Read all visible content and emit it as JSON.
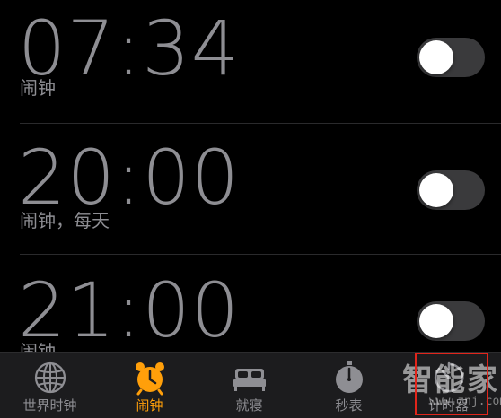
{
  "alarms": [
    {
      "time": "07:34",
      "label": "闹钟",
      "enabled": false
    },
    {
      "time": "20:00",
      "label": "闹钟，每天",
      "enabled": false
    },
    {
      "time": "21:00",
      "label": "闹钟",
      "enabled": false
    }
  ],
  "tabbar": {
    "active": "alarm",
    "accent_color": "#ff9f0a",
    "tabs": [
      {
        "id": "world-clock",
        "label": "世界时钟",
        "icon": "globe-icon"
      },
      {
        "id": "alarm",
        "label": "闹钟",
        "icon": "alarm-clock-icon"
      },
      {
        "id": "bedtime",
        "label": "就寝",
        "icon": "bed-icon"
      },
      {
        "id": "stopwatch",
        "label": "秒表",
        "icon": "stopwatch-icon"
      },
      {
        "id": "timer",
        "label": "计时器",
        "icon": "timer-icon"
      }
    ]
  },
  "watermark": {
    "brand": "智能家",
    "url": "www.znj.com"
  }
}
